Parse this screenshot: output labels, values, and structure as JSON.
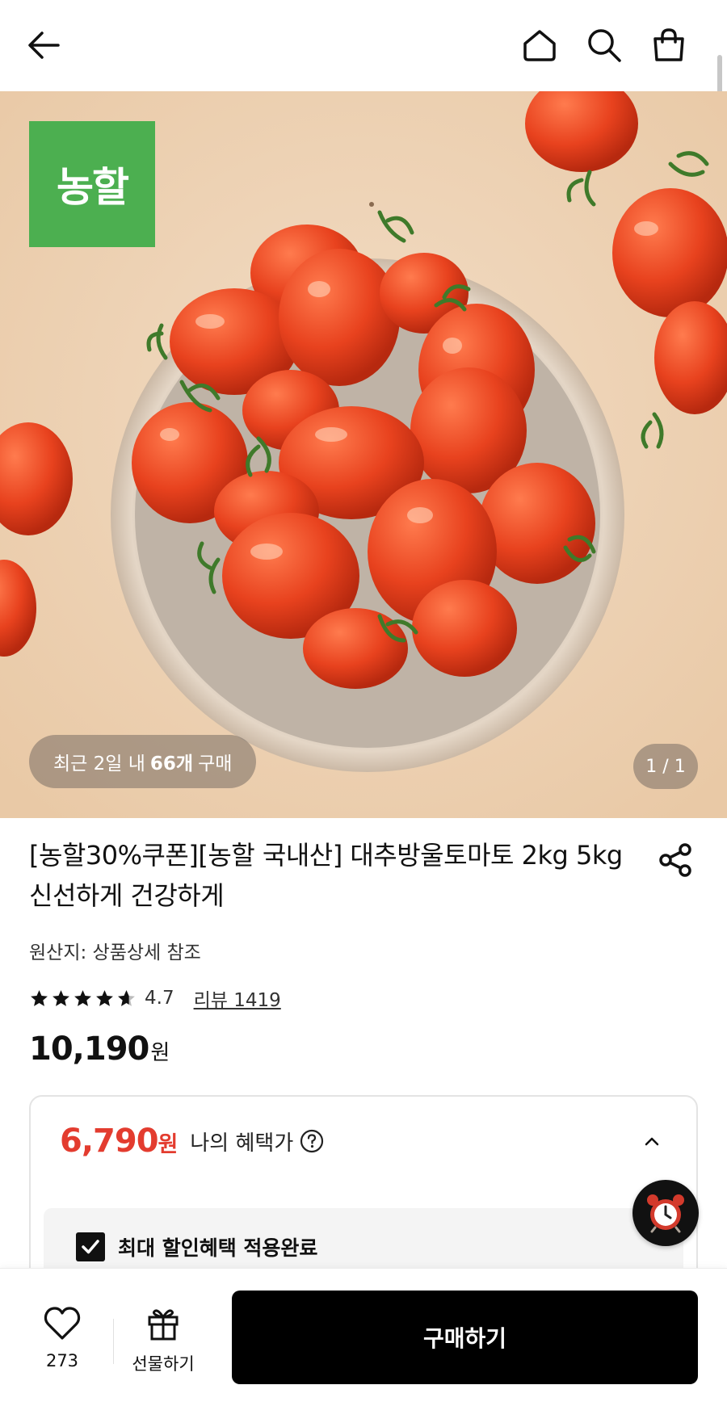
{
  "header": {
    "back_icon": "arrow-left-icon",
    "home_icon": "home-icon",
    "search_icon": "search-icon",
    "bag_icon": "shopping-bag-icon"
  },
  "hero": {
    "brand_logo_text": "농할",
    "recent_prefix": "최근 2일 내 ",
    "recent_count": "66개",
    "recent_suffix": " 구매",
    "pager": "1 / 1"
  },
  "product": {
    "title": "[농할30%쿠폰][농할 국내산] 대추방울토마토 2kg 5kg 신선하게 건강하게",
    "origin": "원산지: 상품상세 참조",
    "rating": "4.7",
    "review_link": "리뷰 1419",
    "price": "10,190",
    "price_unit": "원"
  },
  "benefit": {
    "price": "6,790",
    "price_unit": "원",
    "label": "나의 혜택가",
    "applied_label": "최대 할인혜택 적용완료"
  },
  "bottom": {
    "like_count": "273",
    "gift_label": "선물하기",
    "buy_label": "구매하기"
  },
  "colors": {
    "benefit_price": "#e33c2f",
    "brand_green": "#4caf50",
    "buy_button": "#000000"
  }
}
